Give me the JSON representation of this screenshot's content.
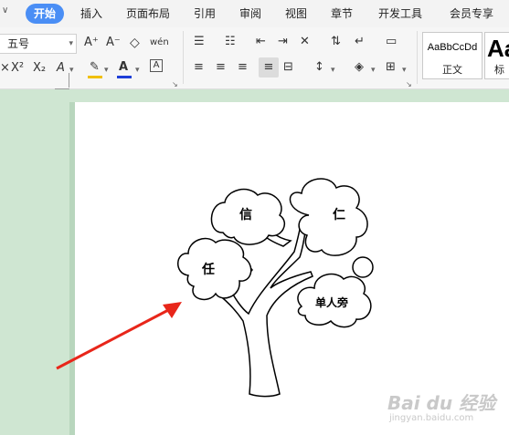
{
  "tabs": {
    "items": [
      "开始",
      "插入",
      "页面布局",
      "引用",
      "审阅",
      "视图",
      "章节",
      "开发工具",
      "会员专享"
    ]
  },
  "ribbon": {
    "font_size": "五号",
    "grow_font": "A⁺",
    "shrink_font": "A⁻",
    "pinyin": "wén",
    "superscript": "X²",
    "subscript": "X₂",
    "style_normal_sample": "AaBbCcDd",
    "style_normal_name": "正文",
    "style_heading_sample": "Aa",
    "style_heading_name": "标"
  },
  "drawing": {
    "labels": {
      "xin": "信",
      "ren_right": "仁",
      "ren_left": "任",
      "danrenpang": "单人旁"
    }
  },
  "watermark": {
    "logo": "Bai du 经验",
    "url": "jingyan.baidu.com"
  },
  "colors": {
    "accent": "#4a8ef5",
    "arrow": "#e8261a",
    "highlight": "#f0c000",
    "font_color": "#1e3fd8"
  }
}
